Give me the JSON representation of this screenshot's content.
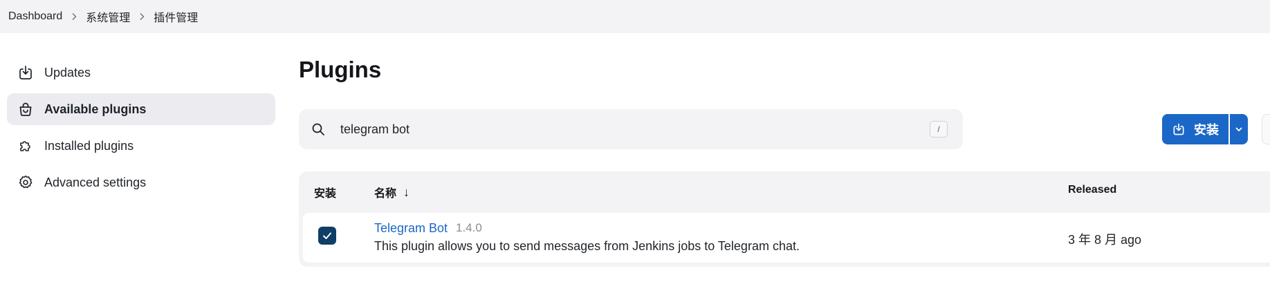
{
  "breadcrumb": {
    "items": [
      "Dashboard",
      "系统管理",
      "插件管理"
    ]
  },
  "sidebar": {
    "items": [
      {
        "label": "Updates",
        "icon": "download-icon"
      },
      {
        "label": "Available plugins",
        "icon": "shopping-bag-icon",
        "active": true
      },
      {
        "label": "Installed plugins",
        "icon": "puzzle-icon"
      },
      {
        "label": "Advanced settings",
        "icon": "gear-icon"
      }
    ]
  },
  "main": {
    "title": "Plugins",
    "search": {
      "value": "telegram bot",
      "shortcut": "/"
    },
    "install_button": {
      "label": "安装"
    },
    "table": {
      "headers": {
        "install": "安装",
        "name": "名称",
        "sort_arrow": "↓",
        "released": "Released"
      },
      "rows": [
        {
          "name": "Telegram Bot",
          "version": "1.4.0",
          "description": "This plugin allows you to send messages from Jenkins jobs to Telegram chat.",
          "released": "3 年 8 月 ago",
          "checked": true
        }
      ]
    }
  },
  "colors": {
    "accent": "#1b67c7",
    "checkbox": "#0f3e66",
    "surface": "#f3f3f6"
  }
}
